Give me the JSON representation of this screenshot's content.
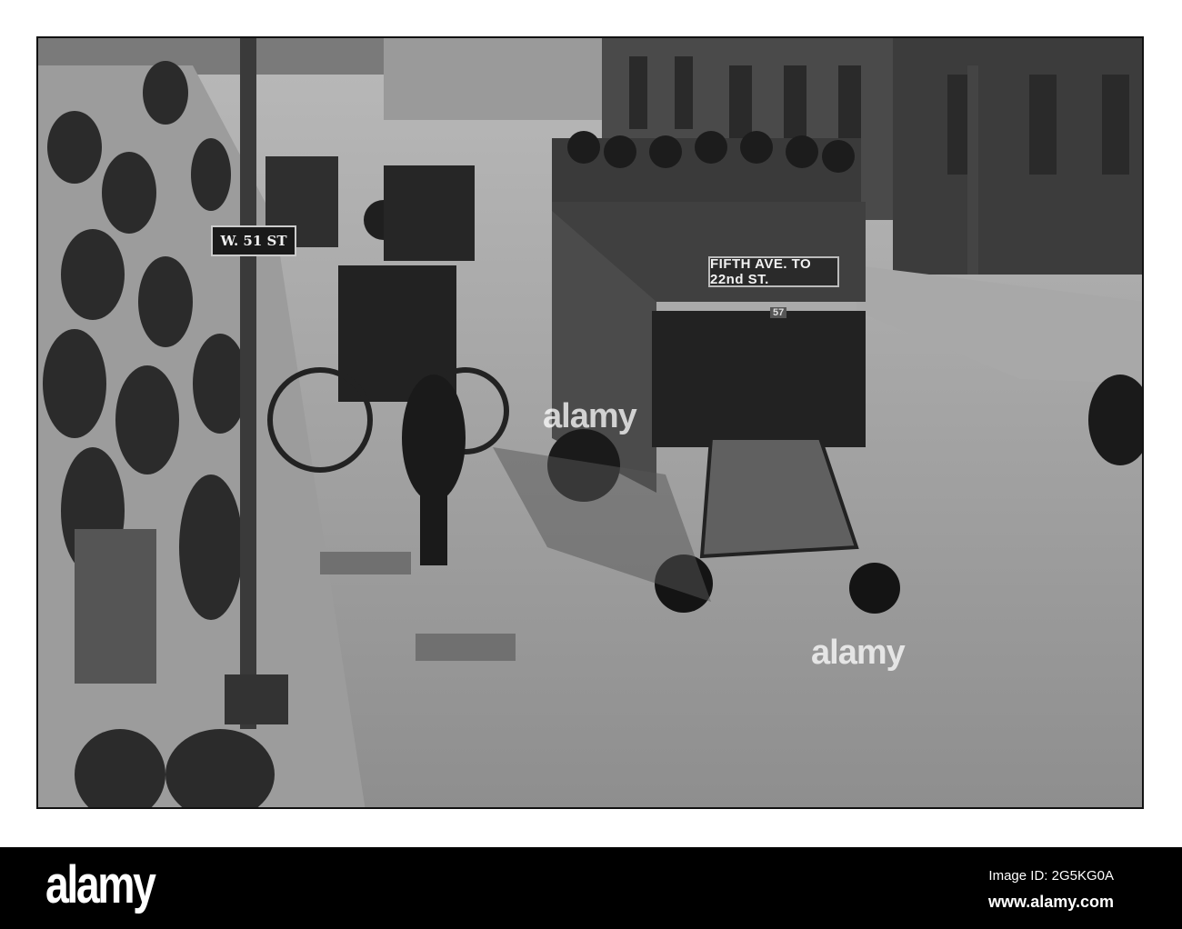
{
  "photo": {
    "street_sign": "W. 51 ST",
    "bus_sign": "FIFTH AVE. TO 22nd ST.",
    "bus_number": "57",
    "watermark": "alamy"
  },
  "footer": {
    "logo": "alamy",
    "image_id": "Image ID: 2G5KG0A",
    "url": "www.alamy.com"
  }
}
